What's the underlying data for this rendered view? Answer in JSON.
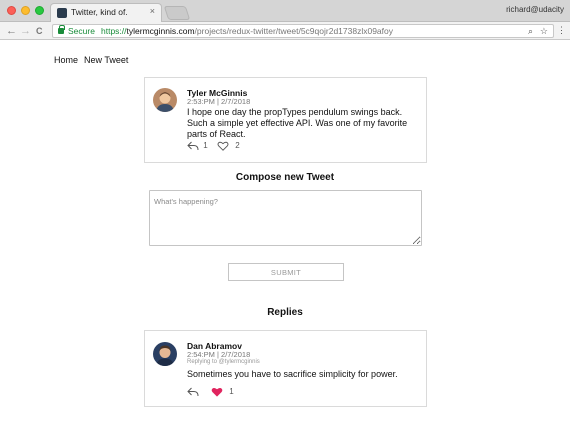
{
  "browser": {
    "tab_title": "Twitter, kind of.",
    "tab_close": "×",
    "profile": "richard@udacity",
    "secure_label": "Secure",
    "url": {
      "scheme": "https://",
      "host": "tylermcginnis.com",
      "path": "/projects/redux-twitter/tweet/5c9qojr2d1738zlx09afoy"
    },
    "back_icon": "←",
    "forward_icon": "→",
    "reload_icon": "C",
    "zoom_icon": "⌕",
    "star_icon": "☆",
    "menu_icon": "⋮"
  },
  "nav": {
    "home": "Home",
    "new_tweet": "New Tweet"
  },
  "tweet": {
    "author": "Tyler McGinnis",
    "meta": "2:53:PM | 2/7/2018",
    "text": "I hope one day the propTypes pendulum swings back. Such a simple yet effective API. Was one of my favorite parts of React.",
    "replies": "1",
    "likes": "2",
    "liked": false
  },
  "compose": {
    "title": "Compose new Tweet",
    "placeholder": "What's happening?",
    "value": "",
    "submit_label": "SUBMIT"
  },
  "replies_section": {
    "title": "Replies",
    "items": [
      {
        "author": "Dan Abramov",
        "meta": "2:54:PM | 2/7/2018",
        "replying_to": "Replying to @tylermcginnis",
        "text": "Sometimes you have to sacrifice simplicity for power.",
        "likes": "1",
        "liked": true
      }
    ]
  },
  "colors": {
    "accent_red": "#e0245e",
    "secure_green": "#198c3a",
    "border": "#dadada"
  }
}
